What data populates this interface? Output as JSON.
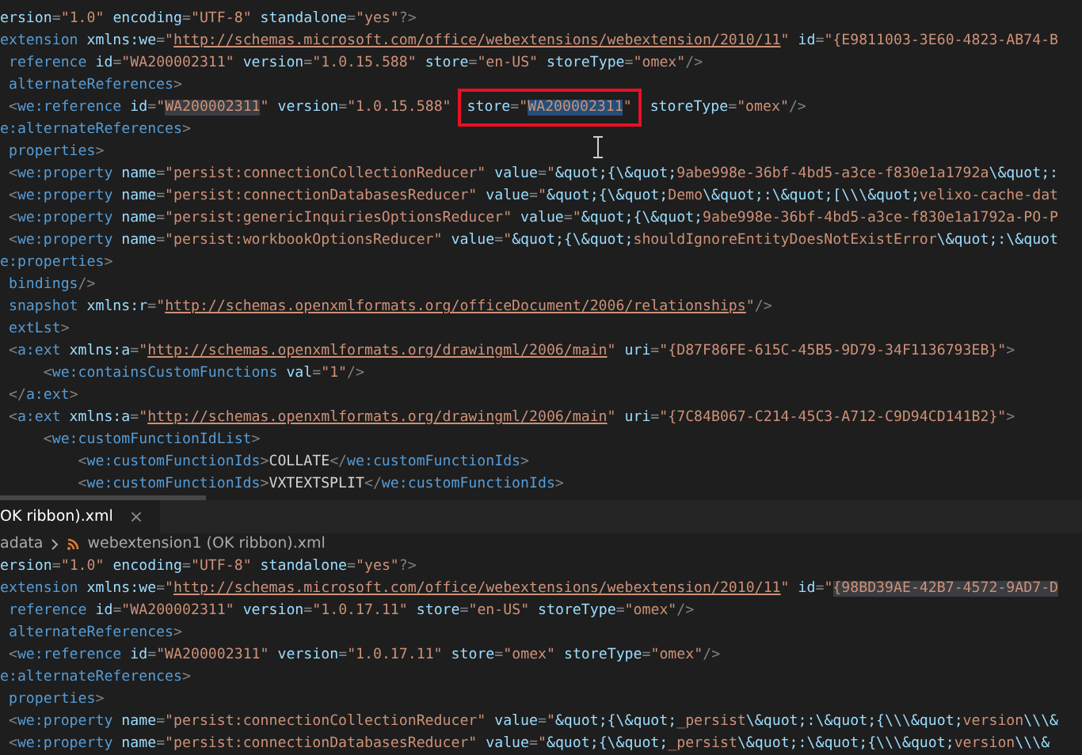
{
  "top_editor": {
    "lines": [
      {
        "tokens": [
          {
            "kind": "attr",
            "text": "ersion"
          },
          {
            "kind": "p",
            "text": "="
          },
          {
            "kind": "str",
            "text": "\"1.0\""
          },
          {
            "kind": "attr",
            "text": " encoding"
          },
          {
            "kind": "p",
            "text": "="
          },
          {
            "kind": "str",
            "text": "\"UTF-8\""
          },
          {
            "kind": "attr",
            "text": " standalone"
          },
          {
            "kind": "p",
            "text": "="
          },
          {
            "kind": "str",
            "text": "\"yes\""
          },
          {
            "kind": "p",
            "text": "?>"
          }
        ]
      },
      {
        "tokens": [
          {
            "kind": "tag",
            "text": "extension"
          },
          {
            "kind": "attr",
            "text": " xmlns:we"
          },
          {
            "kind": "p",
            "text": "="
          },
          {
            "kind": "str",
            "text": "\""
          },
          {
            "kind": "url",
            "text": "http://schemas.microsoft.com/office/webextensions/webextension/2010/11"
          },
          {
            "kind": "str",
            "text": "\""
          },
          {
            "kind": "attr",
            "text": " id"
          },
          {
            "kind": "p",
            "text": "="
          },
          {
            "kind": "str",
            "text": "\"{E9811003-3E60-4823-AB74-B"
          }
        ]
      },
      {
        "tokens": [
          {
            "kind": "tag",
            "text": " reference"
          },
          {
            "kind": "attr",
            "text": " id"
          },
          {
            "kind": "p",
            "text": "="
          },
          {
            "kind": "str",
            "text": "\"WA200002311\""
          },
          {
            "kind": "attr",
            "text": " version"
          },
          {
            "kind": "p",
            "text": "="
          },
          {
            "kind": "str",
            "text": "\"1.0.15.588\""
          },
          {
            "kind": "attr",
            "text": " store"
          },
          {
            "kind": "p",
            "text": "="
          },
          {
            "kind": "str",
            "text": "\"en-US\""
          },
          {
            "kind": "attr",
            "text": " storeType"
          },
          {
            "kind": "p",
            "text": "="
          },
          {
            "kind": "str",
            "text": "\"omex\""
          },
          {
            "kind": "p",
            "text": "/>"
          }
        ]
      },
      {
        "tokens": [
          {
            "kind": "tag",
            "text": " alternateReferences"
          },
          {
            "kind": "p",
            "text": ">"
          }
        ]
      },
      {
        "tokens": [
          {
            "kind": "p",
            "text": " <"
          },
          {
            "kind": "tag",
            "text": "we:reference"
          },
          {
            "kind": "attr",
            "text": " id"
          },
          {
            "kind": "p",
            "text": "="
          },
          {
            "kind": "str",
            "text": "\""
          },
          {
            "kind": "hl",
            "text": "WA200002311"
          },
          {
            "kind": "str",
            "text": "\""
          },
          {
            "kind": "attr",
            "text": " version"
          },
          {
            "kind": "p",
            "text": "="
          },
          {
            "kind": "str",
            "text": "\"1.0.15.588\""
          },
          {
            "kind": "callout",
            "tokens": [
              {
                "kind": "attr",
                "text": "store"
              },
              {
                "kind": "p",
                "text": "="
              },
              {
                "kind": "str",
                "text": "\""
              },
              {
                "kind": "sel",
                "text": "WA200002311"
              },
              {
                "kind": "str",
                "text": "\""
              }
            ]
          },
          {
            "kind": "attr",
            "text": " storeType"
          },
          {
            "kind": "p",
            "text": "="
          },
          {
            "kind": "str",
            "text": "\"omex\""
          },
          {
            "kind": "p",
            "text": "/>"
          }
        ]
      },
      {
        "tokens": [
          {
            "kind": "tag",
            "text": "e:alternateReferences"
          },
          {
            "kind": "p",
            "text": ">"
          }
        ]
      },
      {
        "tokens": [
          {
            "kind": "tag",
            "text": " properties"
          },
          {
            "kind": "p",
            "text": ">"
          }
        ]
      },
      {
        "tokens": [
          {
            "kind": "p",
            "text": " <"
          },
          {
            "kind": "tag",
            "text": "we:property"
          },
          {
            "kind": "attr",
            "text": " name"
          },
          {
            "kind": "p",
            "text": "="
          },
          {
            "kind": "str",
            "text": "\"persist:connectionCollectionReducer\""
          },
          {
            "kind": "attr",
            "text": " value"
          },
          {
            "kind": "p",
            "text": "="
          },
          {
            "kind": "str",
            "text": "\""
          },
          {
            "kind": "ent",
            "text": "&quot;{\\&quot;"
          },
          {
            "kind": "str",
            "text": "9abe998e-36bf-4bd5-a3ce-f830e1a1792a"
          },
          {
            "kind": "ent",
            "text": "\\&quot;:"
          }
        ]
      },
      {
        "tokens": [
          {
            "kind": "p",
            "text": " <"
          },
          {
            "kind": "tag",
            "text": "we:property"
          },
          {
            "kind": "attr",
            "text": " name"
          },
          {
            "kind": "p",
            "text": "="
          },
          {
            "kind": "str",
            "text": "\"persist:connectionDatabasesReducer\""
          },
          {
            "kind": "attr",
            "text": " value"
          },
          {
            "kind": "p",
            "text": "="
          },
          {
            "kind": "str",
            "text": "\""
          },
          {
            "kind": "ent",
            "text": "&quot;{\\&quot;"
          },
          {
            "kind": "str",
            "text": "Demo"
          },
          {
            "kind": "ent",
            "text": "\\&quot;:\\&quot;[\\\\\\&quot;"
          },
          {
            "kind": "str",
            "text": "velixo-cache-dat"
          }
        ]
      },
      {
        "tokens": [
          {
            "kind": "p",
            "text": " <"
          },
          {
            "kind": "tag",
            "text": "we:property"
          },
          {
            "kind": "attr",
            "text": " name"
          },
          {
            "kind": "p",
            "text": "="
          },
          {
            "kind": "str",
            "text": "\"persist:genericInquiriesOptionsReducer\""
          },
          {
            "kind": "attr",
            "text": " value"
          },
          {
            "kind": "p",
            "text": "="
          },
          {
            "kind": "str",
            "text": "\""
          },
          {
            "kind": "ent",
            "text": "&quot;{\\&quot;"
          },
          {
            "kind": "str",
            "text": "9abe998e-36bf-4bd5-a3ce-f830e1a1792a-PO-P"
          }
        ]
      },
      {
        "tokens": [
          {
            "kind": "p",
            "text": " <"
          },
          {
            "kind": "tag",
            "text": "we:property"
          },
          {
            "kind": "attr",
            "text": " name"
          },
          {
            "kind": "p",
            "text": "="
          },
          {
            "kind": "str",
            "text": "\"persist:workbookOptionsReducer\""
          },
          {
            "kind": "attr",
            "text": " value"
          },
          {
            "kind": "p",
            "text": "="
          },
          {
            "kind": "str",
            "text": "\""
          },
          {
            "kind": "ent",
            "text": "&quot;{\\&quot;"
          },
          {
            "kind": "str",
            "text": "shouldIgnoreEntityDoesNotExistError"
          },
          {
            "kind": "ent",
            "text": "\\&quot;:\\&quot"
          }
        ]
      },
      {
        "tokens": [
          {
            "kind": "tag",
            "text": "e:properties"
          },
          {
            "kind": "p",
            "text": ">"
          }
        ]
      },
      {
        "tokens": [
          {
            "kind": "tag",
            "text": " bindings"
          },
          {
            "kind": "p",
            "text": "/>"
          }
        ]
      },
      {
        "tokens": [
          {
            "kind": "tag",
            "text": " snapshot"
          },
          {
            "kind": "attr",
            "text": " xmlns:r"
          },
          {
            "kind": "p",
            "text": "="
          },
          {
            "kind": "str",
            "text": "\""
          },
          {
            "kind": "url",
            "text": "http://schemas.openxmlformats.org/officeDocument/2006/relationships"
          },
          {
            "kind": "str",
            "text": "\""
          },
          {
            "kind": "p",
            "text": "/>"
          }
        ]
      },
      {
        "tokens": [
          {
            "kind": "tag",
            "text": " extLst"
          },
          {
            "kind": "p",
            "text": ">"
          }
        ]
      },
      {
        "tokens": [
          {
            "kind": "p",
            "text": " <"
          },
          {
            "kind": "tag",
            "text": "a:ext"
          },
          {
            "kind": "attr",
            "text": " xmlns:a"
          },
          {
            "kind": "p",
            "text": "="
          },
          {
            "kind": "str",
            "text": "\""
          },
          {
            "kind": "url",
            "text": "http://schemas.openxmlformats.org/drawingml/2006/main"
          },
          {
            "kind": "str",
            "text": "\""
          },
          {
            "kind": "attr",
            "text": " uri"
          },
          {
            "kind": "p",
            "text": "="
          },
          {
            "kind": "str",
            "text": "\"{D87F86FE-615C-45B5-9D79-34F1136793EB}\""
          },
          {
            "kind": "p",
            "text": ">"
          }
        ]
      },
      {
        "tokens": [
          {
            "kind": "p",
            "text": "     <"
          },
          {
            "kind": "tag",
            "text": "we:containsCustomFunctions"
          },
          {
            "kind": "attr",
            "text": " val"
          },
          {
            "kind": "p",
            "text": "="
          },
          {
            "kind": "str",
            "text": "\"1\""
          },
          {
            "kind": "p",
            "text": "/>"
          }
        ]
      },
      {
        "tokens": [
          {
            "kind": "p",
            "text": " </"
          },
          {
            "kind": "tag",
            "text": "a:ext"
          },
          {
            "kind": "p",
            "text": ">"
          }
        ]
      },
      {
        "tokens": [
          {
            "kind": "p",
            "text": " <"
          },
          {
            "kind": "tag",
            "text": "a:ext"
          },
          {
            "kind": "attr",
            "text": " xmlns:a"
          },
          {
            "kind": "p",
            "text": "="
          },
          {
            "kind": "str",
            "text": "\""
          },
          {
            "kind": "url",
            "text": "http://schemas.openxmlformats.org/drawingml/2006/main"
          },
          {
            "kind": "str",
            "text": "\""
          },
          {
            "kind": "attr",
            "text": " uri"
          },
          {
            "kind": "p",
            "text": "="
          },
          {
            "kind": "str",
            "text": "\"{7C84B067-C214-45C3-A712-C9D94CD141B2}\""
          },
          {
            "kind": "p",
            "text": ">"
          }
        ]
      },
      {
        "tokens": [
          {
            "kind": "p",
            "text": "     <"
          },
          {
            "kind": "tag",
            "text": "we:customFunctionIdList"
          },
          {
            "kind": "p",
            "text": ">"
          }
        ]
      },
      {
        "tokens": [
          {
            "kind": "p",
            "text": "         <"
          },
          {
            "kind": "tag",
            "text": "we:customFunctionIds"
          },
          {
            "kind": "p",
            "text": ">"
          },
          {
            "kind": "text",
            "text": "COLLATE"
          },
          {
            "kind": "p",
            "text": "</"
          },
          {
            "kind": "tag",
            "text": "we:customFunctionIds"
          },
          {
            "kind": "p",
            "text": ">"
          }
        ]
      },
      {
        "tokens": [
          {
            "kind": "p",
            "text": "         <"
          },
          {
            "kind": "tag",
            "text": "we:customFunctionIds"
          },
          {
            "kind": "p",
            "text": ">"
          },
          {
            "kind": "text",
            "text": "VXTEXTSPLIT"
          },
          {
            "kind": "p",
            "text": "</"
          },
          {
            "kind": "tag",
            "text": "we:customFunctionIds"
          },
          {
            "kind": "p",
            "text": ">"
          }
        ]
      }
    ]
  },
  "tabs": [
    {
      "label": "OK ribbon).xml",
      "close": "×",
      "selected": true
    }
  ],
  "breadcrumb": [
    {
      "label": "adata"
    },
    {
      "label": "webextension1 (OK ribbon).xml"
    }
  ],
  "bottom_editor": {
    "lines": [
      {
        "tokens": [
          {
            "kind": "attr",
            "text": "ersion"
          },
          {
            "kind": "p",
            "text": "="
          },
          {
            "kind": "str",
            "text": "\"1.0\""
          },
          {
            "kind": "attr",
            "text": " encoding"
          },
          {
            "kind": "p",
            "text": "="
          },
          {
            "kind": "str",
            "text": "\"UTF-8\""
          },
          {
            "kind": "attr",
            "text": " standalone"
          },
          {
            "kind": "p",
            "text": "="
          },
          {
            "kind": "str",
            "text": "\"yes\""
          },
          {
            "kind": "p",
            "text": "?>"
          }
        ]
      },
      {
        "tokens": [
          {
            "kind": "tag",
            "text": "extension"
          },
          {
            "kind": "attr",
            "text": " xmlns:we"
          },
          {
            "kind": "p",
            "text": "="
          },
          {
            "kind": "str",
            "text": "\""
          },
          {
            "kind": "url",
            "text": "http://schemas.microsoft.com/office/webextensions/webextension/2010/11"
          },
          {
            "kind": "str",
            "text": "\""
          },
          {
            "kind": "attr",
            "text": " id"
          },
          {
            "kind": "p",
            "text": "="
          },
          {
            "kind": "str",
            "text": "\""
          },
          {
            "kind": "hl",
            "text": "{98BD39AE-42B7-4572-9AD7-D"
          }
        ]
      },
      {
        "tokens": [
          {
            "kind": "tag",
            "text": " reference"
          },
          {
            "kind": "attr",
            "text": " id"
          },
          {
            "kind": "p",
            "text": "="
          },
          {
            "kind": "str",
            "text": "\"WA200002311\""
          },
          {
            "kind": "attr",
            "text": " version"
          },
          {
            "kind": "p",
            "text": "="
          },
          {
            "kind": "str",
            "text": "\"1.0.17.11\""
          },
          {
            "kind": "attr",
            "text": " store"
          },
          {
            "kind": "p",
            "text": "="
          },
          {
            "kind": "str",
            "text": "\"en-US\""
          },
          {
            "kind": "attr",
            "text": " storeType"
          },
          {
            "kind": "p",
            "text": "="
          },
          {
            "kind": "str",
            "text": "\"omex\""
          },
          {
            "kind": "p",
            "text": "/>"
          }
        ]
      },
      {
        "tokens": [
          {
            "kind": "tag",
            "text": " alternateReferences"
          },
          {
            "kind": "p",
            "text": ">"
          }
        ]
      },
      {
        "tokens": [
          {
            "kind": "p",
            "text": " <"
          },
          {
            "kind": "tag",
            "text": "we:reference"
          },
          {
            "kind": "attr",
            "text": " id"
          },
          {
            "kind": "p",
            "text": "="
          },
          {
            "kind": "str",
            "text": "\"WA200002311\""
          },
          {
            "kind": "attr",
            "text": " version"
          },
          {
            "kind": "p",
            "text": "="
          },
          {
            "kind": "str",
            "text": "\"1.0.17.11\""
          },
          {
            "kind": "attr",
            "text": " store"
          },
          {
            "kind": "p",
            "text": "="
          },
          {
            "kind": "str",
            "text": "\"omex\""
          },
          {
            "kind": "attr",
            "text": " storeType"
          },
          {
            "kind": "p",
            "text": "="
          },
          {
            "kind": "str",
            "text": "\"omex\""
          },
          {
            "kind": "p",
            "text": "/>"
          }
        ]
      },
      {
        "tokens": [
          {
            "kind": "tag",
            "text": "e:alternateReferences"
          },
          {
            "kind": "p",
            "text": ">"
          }
        ]
      },
      {
        "tokens": [
          {
            "kind": "tag",
            "text": " properties"
          },
          {
            "kind": "p",
            "text": ">"
          }
        ]
      },
      {
        "tokens": [
          {
            "kind": "p",
            "text": " <"
          },
          {
            "kind": "tag",
            "text": "we:property"
          },
          {
            "kind": "attr",
            "text": " name"
          },
          {
            "kind": "p",
            "text": "="
          },
          {
            "kind": "str",
            "text": "\"persist:connectionCollectionReducer\""
          },
          {
            "kind": "attr",
            "text": " value"
          },
          {
            "kind": "p",
            "text": "="
          },
          {
            "kind": "str",
            "text": "\""
          },
          {
            "kind": "ent",
            "text": "&quot;{\\&quot;"
          },
          {
            "kind": "str",
            "text": "_persist"
          },
          {
            "kind": "ent",
            "text": "\\&quot;:\\&quot;{\\\\\\&quot;"
          },
          {
            "kind": "str",
            "text": "version"
          },
          {
            "kind": "ent",
            "text": "\\\\\\&"
          }
        ]
      },
      {
        "tokens": [
          {
            "kind": "p",
            "text": " <"
          },
          {
            "kind": "tag",
            "text": "we:property"
          },
          {
            "kind": "attr",
            "text": " name"
          },
          {
            "kind": "p",
            "text": "="
          },
          {
            "kind": "str",
            "text": "\"persist:connectionDatabasesReducer\""
          },
          {
            "kind": "attr",
            "text": " value"
          },
          {
            "kind": "p",
            "text": "="
          },
          {
            "kind": "str",
            "text": "\""
          },
          {
            "kind": "ent",
            "text": "&quot;{\\&quot;"
          },
          {
            "kind": "str",
            "text": "_persist"
          },
          {
            "kind": "ent",
            "text": "\\&quot;:\\&quot;{\\\\\\&quot;"
          },
          {
            "kind": "str",
            "text": "version"
          },
          {
            "kind": "ent",
            "text": "\\\\\\&"
          }
        ]
      }
    ]
  }
}
